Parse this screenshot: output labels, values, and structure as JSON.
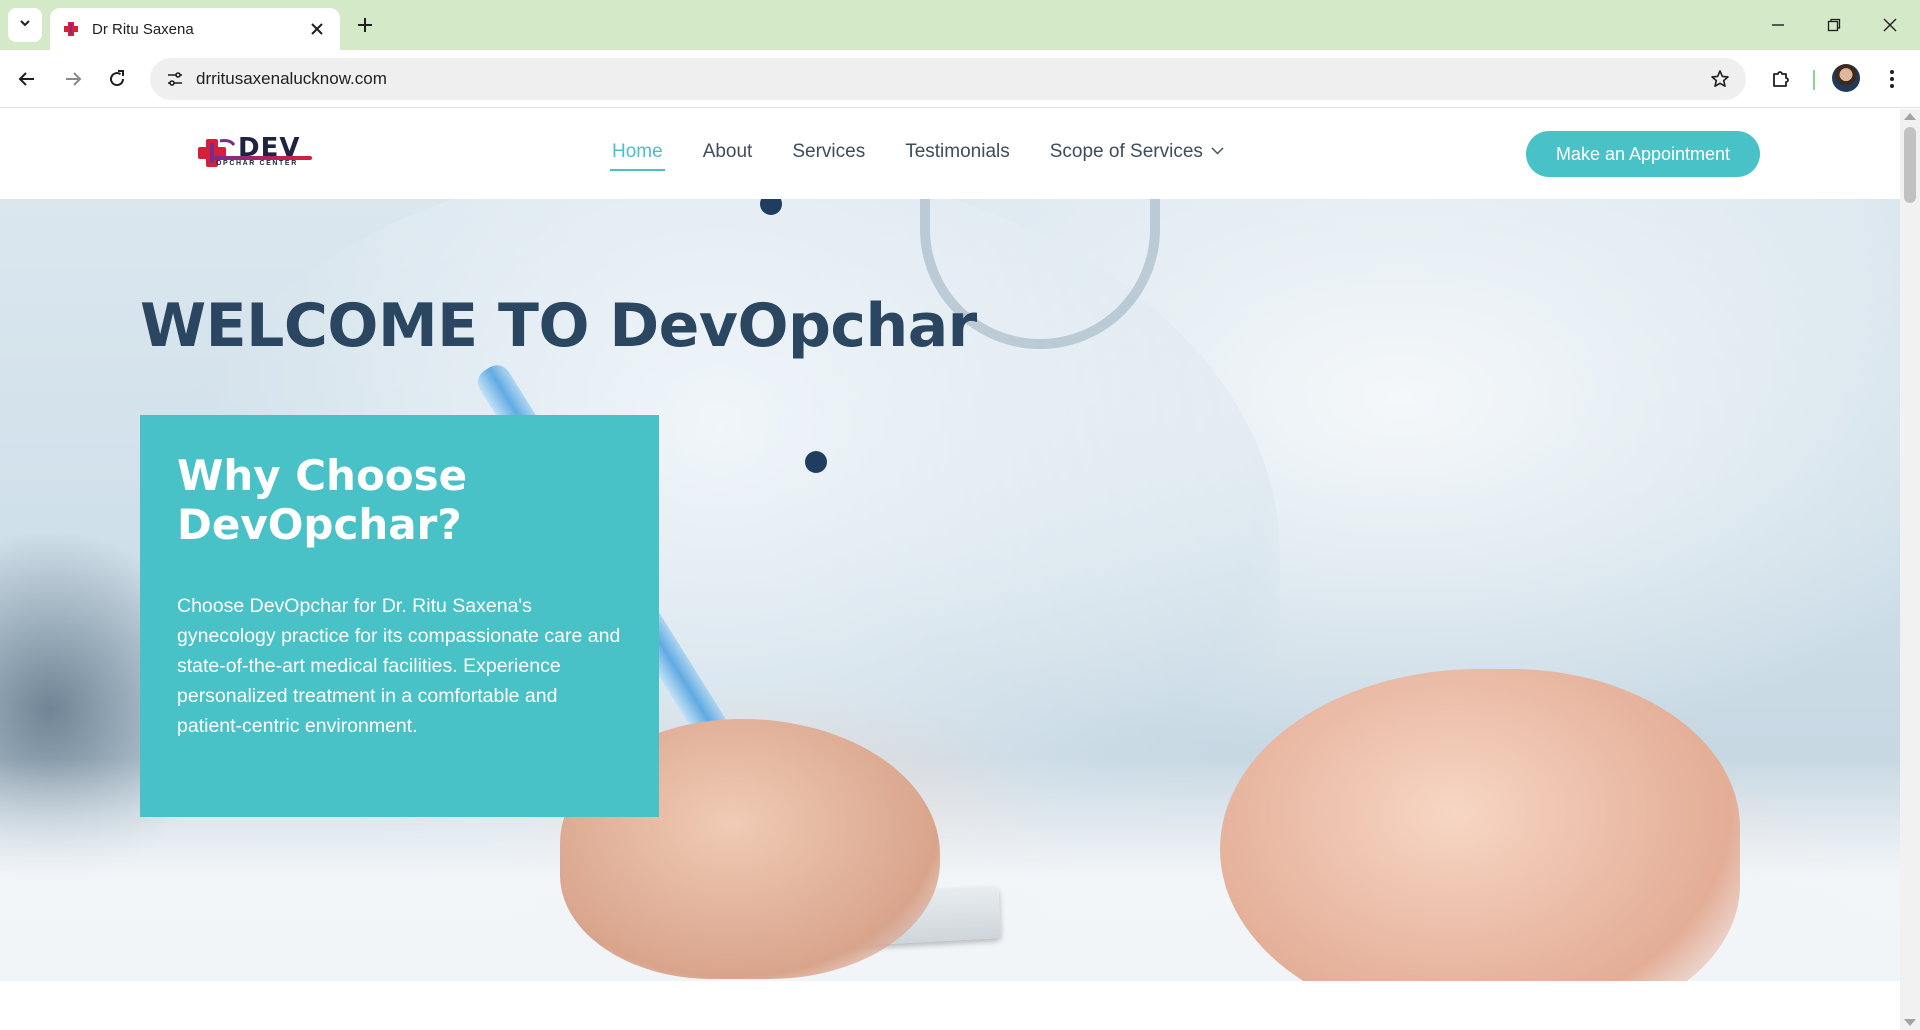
{
  "browser": {
    "tab_title": "Dr Ritu Saxena",
    "url": "drritusaxenalucknow.com",
    "icons": {
      "tab_list": "chevron-down-icon",
      "favicon": "plus-cross-favicon",
      "close": "close-icon",
      "new_tab": "plus-icon",
      "back": "arrow-left-icon",
      "forward": "arrow-right-icon",
      "reload": "reload-icon",
      "site_info": "tune-icon",
      "bookmark": "star-icon",
      "extensions": "puzzle-icon",
      "menu": "kebab-menu-icon"
    }
  },
  "site": {
    "logo": {
      "text": "DEV",
      "subtext": "OPCHAR CENTER"
    },
    "nav": {
      "home": "Home",
      "about": "About",
      "services": "Services",
      "testimonials": "Testimonials",
      "scope": "Scope of Services"
    },
    "cta_label": "Make an Appointment",
    "colors": {
      "accent": "#48c1c7",
      "heading": "#2b4660",
      "nav_text": "#3d4d5c"
    }
  },
  "hero": {
    "title": "WELCOME TO DevOpchar",
    "card_title": "Why Choose DevOpchar?",
    "card_text": "Choose DevOpchar for Dr. Ritu Saxena's gynecology practice for its compassionate care and state-of-the-art medical facilities. Experience personalized treatment in a comfortable and patient-centric environment."
  }
}
